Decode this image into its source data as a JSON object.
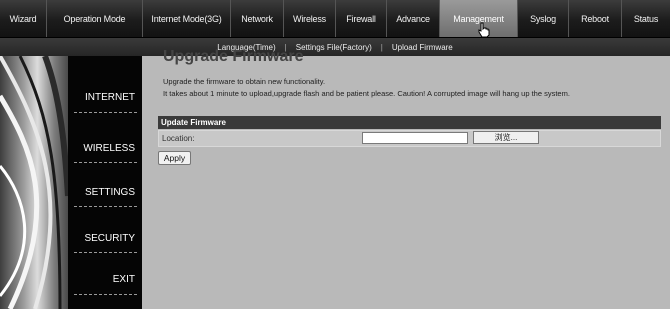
{
  "top_nav": {
    "items": [
      {
        "label": "Wizard",
        "active": false
      },
      {
        "label": "Operation Mode",
        "active": false
      },
      {
        "label": "Internet Mode(3G)",
        "active": false
      },
      {
        "label": "Network",
        "active": false
      },
      {
        "label": "Wireless",
        "active": false
      },
      {
        "label": "Firewall",
        "active": false
      },
      {
        "label": "Advance",
        "active": false
      },
      {
        "label": "Management",
        "active": true
      },
      {
        "label": "Syslog",
        "active": false
      },
      {
        "label": "Reboot",
        "active": false
      },
      {
        "label": "Status",
        "active": false
      }
    ]
  },
  "sub_nav": {
    "items": [
      "Language(Time)",
      "Settings File(Factory)",
      "Upload Firmware"
    ],
    "separator": "|"
  },
  "side_menu": {
    "items": [
      "INTERNET",
      "WIRELESS",
      "SETTINGS",
      "SECURITY",
      "EXIT"
    ]
  },
  "main": {
    "title": "Upgrade Firmware",
    "description_line1": "Upgrade the firmware to obtain new functionality.",
    "description_line2": "It takes about 1 minute to upload,upgrade flash and be patient please. Caution! A corrupted image will hang up the system.",
    "section_header": "Update Firmware",
    "location_label": "Location:",
    "location_value": "",
    "browse_label": "浏览...",
    "apply_label": "Apply"
  }
}
